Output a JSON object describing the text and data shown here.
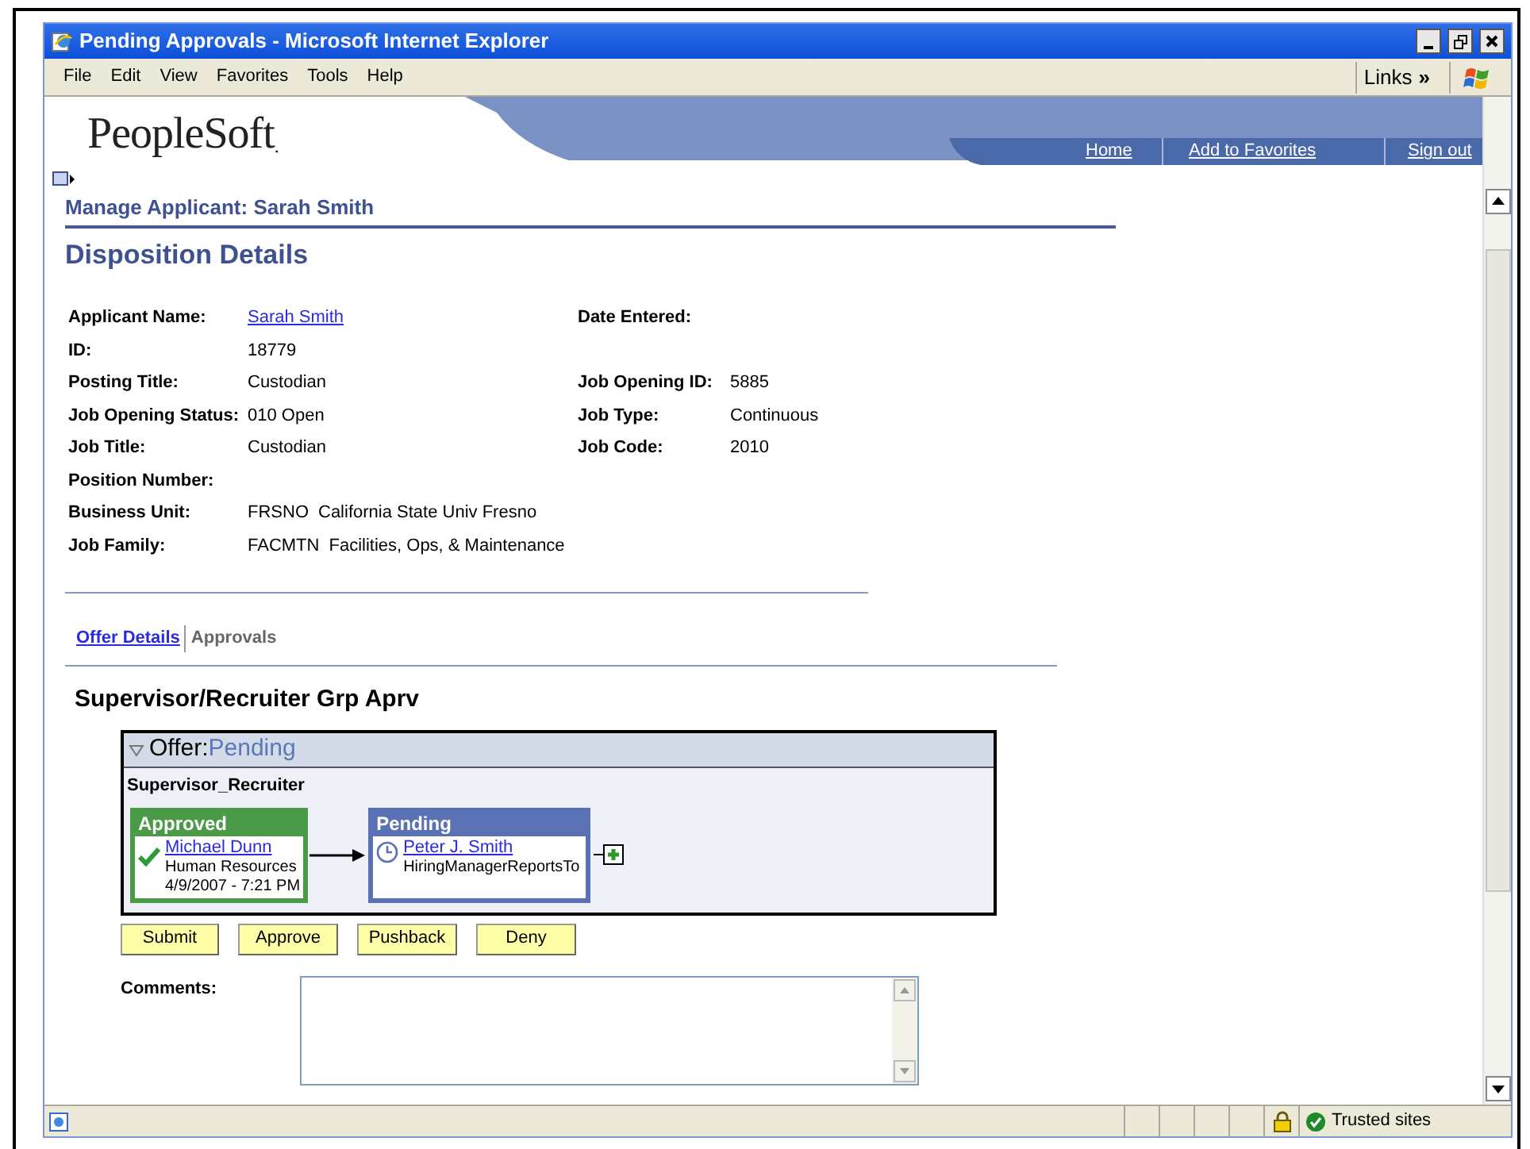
{
  "window": {
    "title": "Pending Approvals - Microsoft Internet Explorer"
  },
  "menu": [
    "File",
    "Edit",
    "View",
    "Favorites",
    "Tools",
    "Help"
  ],
  "links_toolbar": {
    "label": "Links",
    "chevron": "»"
  },
  "header": {
    "logo": "PeopleSoft",
    "dot": ".",
    "links": [
      "Home",
      "Add to Favorites",
      "Sign out"
    ]
  },
  "breadcrumb": "Manage Applicant: Sarah Smith",
  "page_title": "Disposition Details",
  "fields": [
    {
      "left": {
        "label": "Applicant Name:",
        "value": "Sarah Smith",
        "link": true
      },
      "right": {
        "label": "Date Entered:"
      }
    },
    {
      "left": {
        "label": "ID:",
        "value": "18779",
        "link": false
      }
    },
    {
      "left": {
        "label": "Posting Title:",
        "value": "Custodian",
        "link": false
      },
      "right": {
        "label": "Job Opening ID:",
        "value": "5885"
      }
    },
    {
      "left": {
        "label": "Job Opening Status:",
        "value": "010 Open",
        "link": false
      },
      "right": {
        "label": "Job Type:",
        "value": "Continuous"
      }
    },
    {
      "left": {
        "label": "Job Title:",
        "value": "Custodian",
        "link": false
      },
      "right": {
        "label": "Job Code:",
        "value": "2010"
      }
    },
    {
      "left": {
        "label": "Position Number:"
      }
    },
    {
      "left": {
        "label": "Business Unit:",
        "code": "FRSNO",
        "description": "California State Univ Fresno"
      }
    },
    {
      "left": {
        "label": "Job Family:",
        "code": "FACMTN",
        "description": "Facilities, Ops, & Maintenance"
      }
    }
  ],
  "tabs": [
    {
      "label": "Offer Details",
      "selected": false
    },
    {
      "label": "Approvals",
      "selected": true
    }
  ],
  "section_title": "Supervisor/Recruiter Grp Aprv",
  "approval": {
    "expanded": true,
    "prefix": "Offer:",
    "status": "Pending",
    "group": "Supervisor_Recruiter",
    "steps": [
      {
        "kind": "approved",
        "status": "Approved",
        "name": "Michael Dunn",
        "lines": [
          "Human Resources",
          "4/9/2007 - 7:21 PM"
        ]
      },
      {
        "kind": "pending",
        "status": "Pending",
        "name": "Peter J. Smith",
        "lines": [
          "HiringManagerReportsTo"
        ]
      }
    ]
  },
  "buttons": [
    "Submit",
    "Approve",
    "Pushback",
    "Deny"
  ],
  "comments": {
    "label": "Comments:"
  },
  "status_bar": {
    "zone": "Trusted sites"
  }
}
